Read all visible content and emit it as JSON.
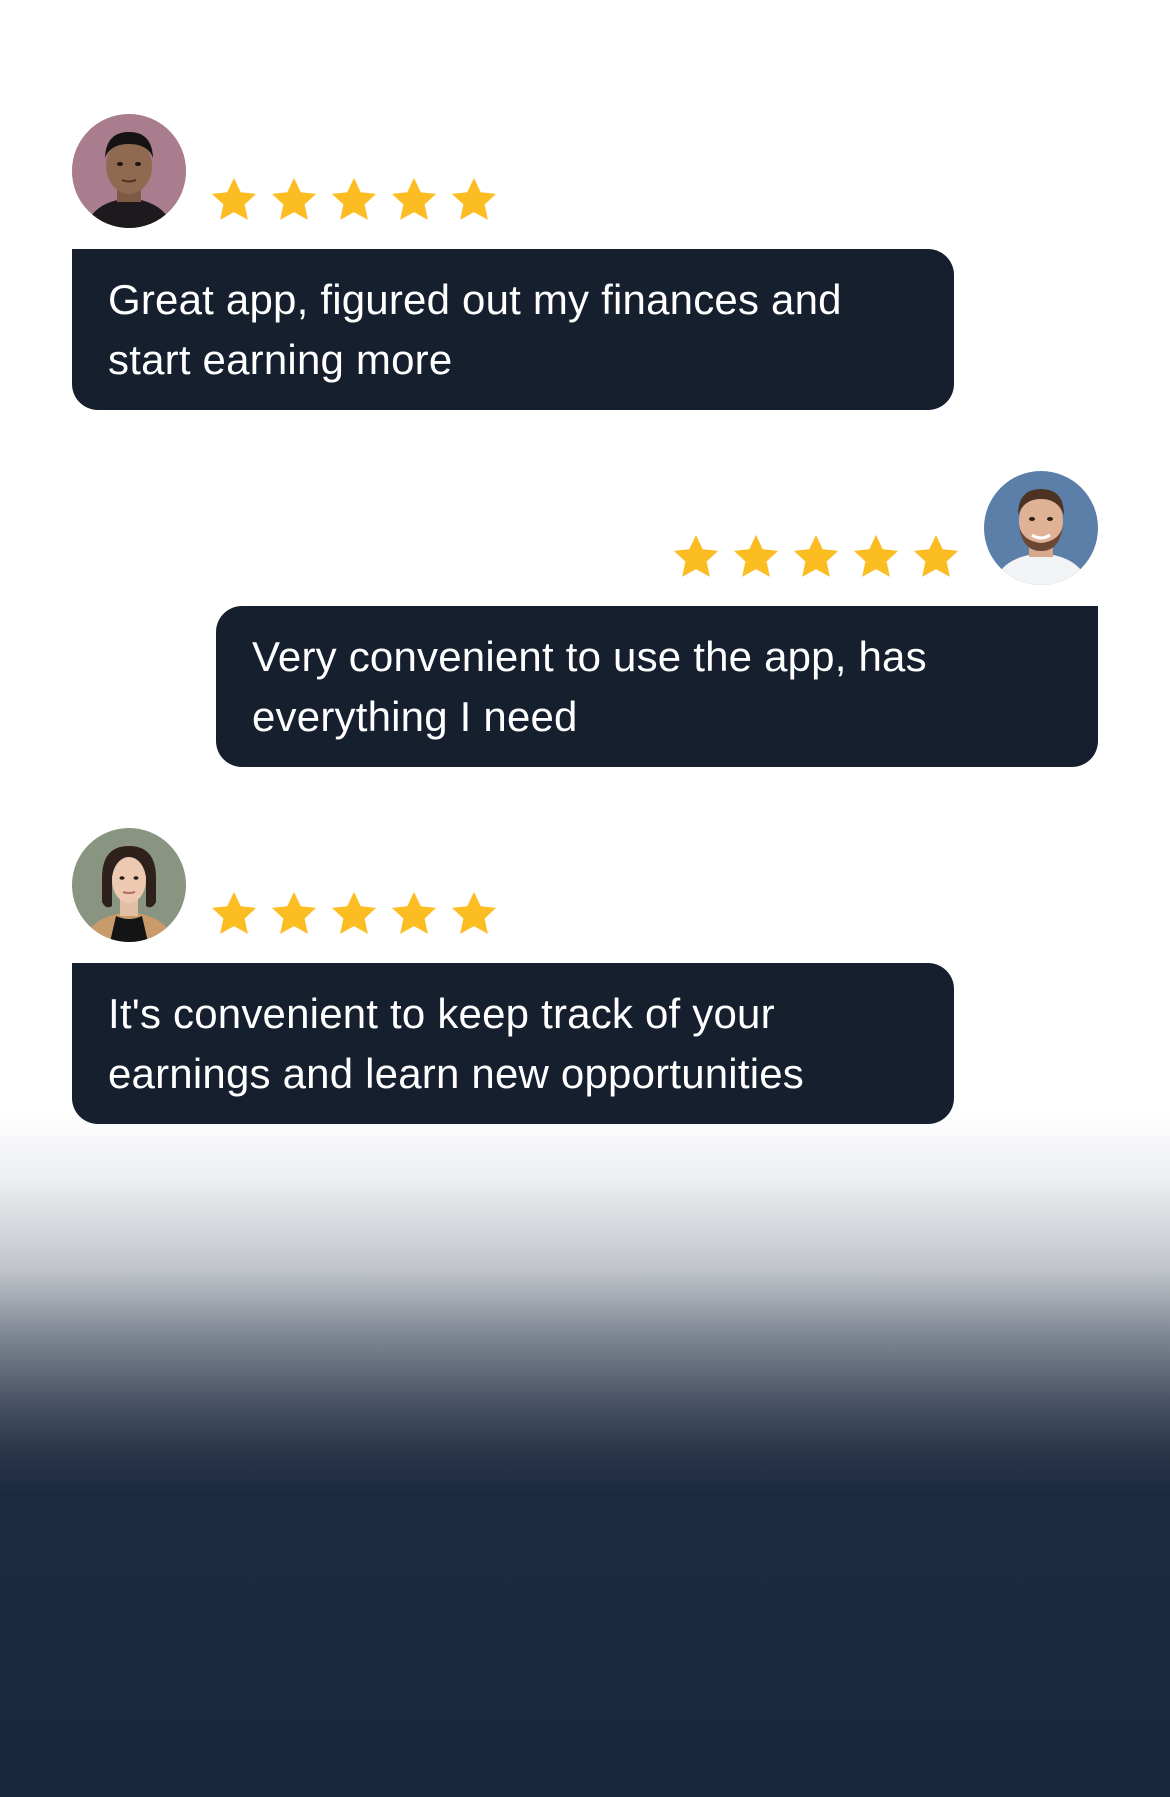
{
  "colors": {
    "bubble_bg": "#151f2e",
    "bubble_text": "#ffffff",
    "star": "#fbbd22",
    "bottom_gradient": "#1a283e"
  },
  "reviews": [
    {
      "rating": 5,
      "align": "left",
      "avatar_icon": "man-portrait",
      "text": "Great app, figured out my finances and start earning more"
    },
    {
      "rating": 5,
      "align": "right",
      "avatar_icon": "bearded-man-portrait",
      "text": "Very convenient to use the app, has everything I need"
    },
    {
      "rating": 5,
      "align": "left",
      "avatar_icon": "woman-portrait",
      "text": "It's convenient to keep track of your earnings and learn new opportunities"
    }
  ]
}
